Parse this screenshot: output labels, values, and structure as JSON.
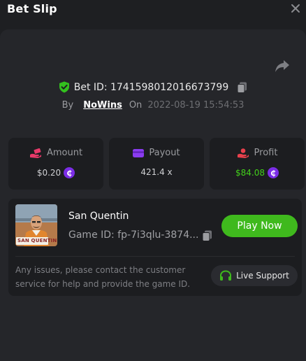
{
  "header": {
    "title": "Bet Slip"
  },
  "bet": {
    "id_label": "Bet ID: 1741598012016673799",
    "by_label": "By",
    "username": "NoWins",
    "on_label": "On",
    "date": "2022-08-19 15:54:53"
  },
  "stats": {
    "amount_label": "Amount",
    "amount_value": "$0.20",
    "payout_label": "Payout",
    "payout_value": "421.4 x",
    "profit_label": "Profit",
    "profit_value": "$84.08",
    "coin_symbol": "₵"
  },
  "game": {
    "name": "San Quentin",
    "id_text": "Game ID: fp-7i3qlu-3874...",
    "thumbnail_text": "SAN QUENTIN",
    "play_label": "Play Now",
    "notice": "Any issues, please contact the customer service for help and provide the game ID.",
    "support_label": "Live Support"
  },
  "colors": {
    "accent_green": "#3fb91d",
    "coin_purple": "#7b2de6",
    "profit_green": "#43d01b",
    "amount_pink": "#e83a6a",
    "payout_purple": "#8a3cf0",
    "profit_red": "#e8404c"
  },
  "icons": {
    "close": "close-icon",
    "share": "share-icon",
    "shield": "shield-check-icon",
    "copy": "copy-icon",
    "amount": "hand-money-icon",
    "payout": "wallet-icon",
    "profit": "user-hand-icon",
    "support": "headset-icon"
  }
}
